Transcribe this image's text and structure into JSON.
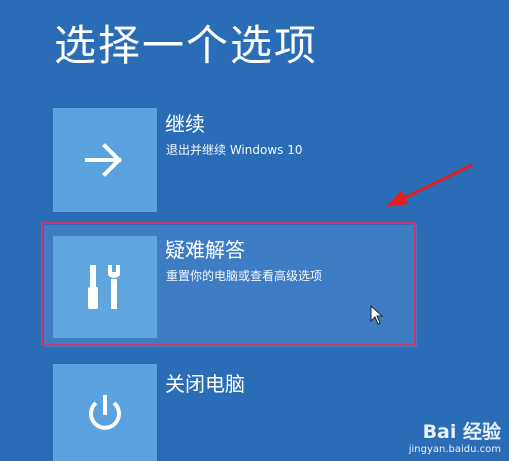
{
  "title": "选择一个选项",
  "options": [
    {
      "label": "继续",
      "description": "退出并继续 Windows 10",
      "icon": "arrow-right-icon"
    },
    {
      "label": "疑难解答",
      "description": "重置你的电脑或查看高级选项",
      "icon": "tools-icon"
    },
    {
      "label": "关闭电脑",
      "description": "",
      "icon": "power-icon"
    }
  ],
  "colors": {
    "background": "#2a6cb6",
    "tile": "#5aa3de",
    "highlight_frame": "#c53a6e",
    "annotation_arrow": "#e02020"
  },
  "watermark": {
    "brand": "Bai  经验",
    "url": "jingyan.baidu.com"
  }
}
